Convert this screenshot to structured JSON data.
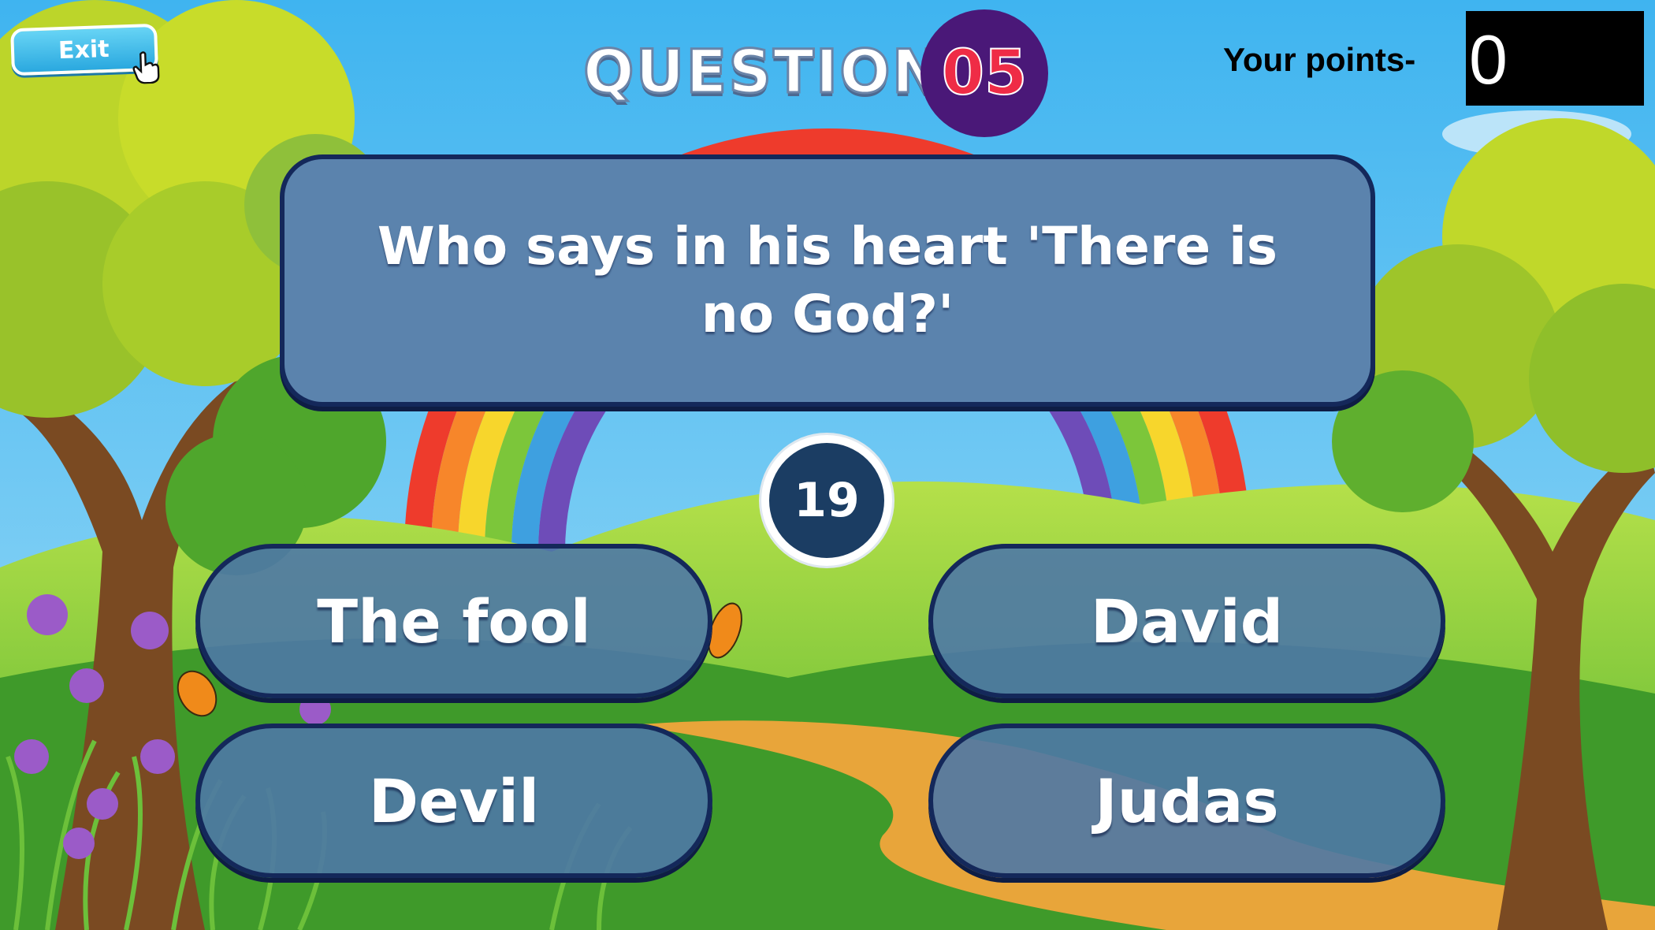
{
  "game": {
    "exit_label": "Exit",
    "question_label": "QUESTION",
    "question_number": "05",
    "points_label": "Your points-",
    "points_value": "0",
    "question_text": "Who says in his heart 'There is no God?'",
    "timer_value": "19",
    "answers": [
      "The fool",
      "David",
      "Devil",
      "Judas"
    ]
  },
  "colors": {
    "sky": "#5fc3f4",
    "answer_fill": "#4e78a6",
    "card_border": "#14285a",
    "number_circle": "#4a1878",
    "number_text": "#ef2c46",
    "timer_fill": "#1b3d63"
  },
  "icons": [
    "hand-cursor-icon",
    "butterfly-icon"
  ]
}
